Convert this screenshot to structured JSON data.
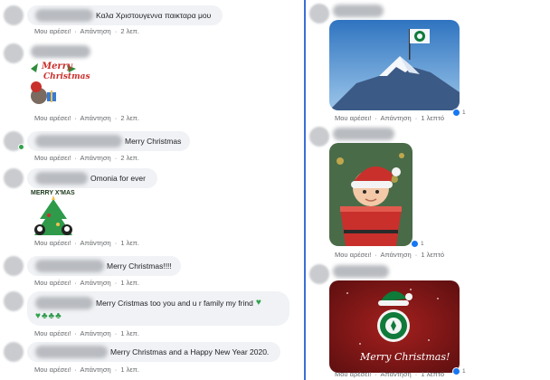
{
  "meta": {
    "like": "Μου αρέσει!",
    "reply": "Απάντηση",
    "sep": "·"
  },
  "left_comments": [
    {
      "text": "Καλα Χριστουγεννα παικταρα μου",
      "time": "2 λεπ."
    },
    {
      "sticker_text_1": "Merry",
      "sticker_text_2": "Christmas",
      "time": "2 λεπ."
    },
    {
      "text": "Merry Christmas",
      "time": "2 λεπ."
    },
    {
      "text": "Omonia for ever",
      "sticker_text": "MERRY X'MAS",
      "time": "1 λεπ."
    },
    {
      "text": "Merry Christmas!!!!",
      "time": "1 λεπ."
    },
    {
      "text_prefix": "Marios Vasilis",
      "text": "Merry Cristmas too you and u r family my frind",
      "time": "1 λεπ."
    },
    {
      "text": "Merry Christmas and a Happy New Year 2020.",
      "time": "1 λεπ."
    }
  ],
  "right_comments": [
    {
      "time": "1 λεπτό",
      "reactions": "1"
    },
    {
      "time": "1 λεπτό",
      "reactions": "1"
    },
    {
      "time": "1 λεπτό",
      "reactions": "1",
      "card_text": "Merry Christmas!"
    }
  ],
  "colors": {
    "divider": "#3b6fd6",
    "bubble": "#f0f2f5",
    "meta": "#65676b",
    "online": "#31a24c",
    "club_green": "#0f7a3a"
  },
  "icons": [
    "heart-icon",
    "clover-icon"
  ]
}
